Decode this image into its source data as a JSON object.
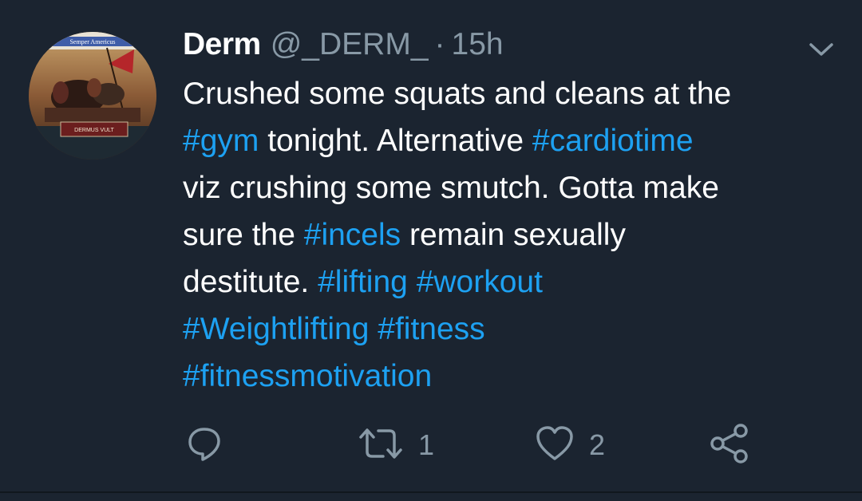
{
  "tweet": {
    "avatar": {
      "banner_text": "Semper Americus",
      "plaque_text": "DERMUS VULT"
    },
    "author": {
      "display_name": "Derm",
      "handle": "@_DERM_",
      "separator": "·",
      "time": "15h"
    },
    "menu_icon": "chevron-down-icon",
    "body_lines": [
      [
        {
          "text": "Crushed some squats and cleans at the",
          "hashtag": false
        }
      ],
      [
        {
          "text": "#gym",
          "hashtag": true
        },
        {
          "text": " tonight. Alternative ",
          "hashtag": false
        },
        {
          "text": "#cardiotime",
          "hashtag": true
        }
      ],
      [
        {
          "text": "viz crushing some smutch. Gotta make",
          "hashtag": false
        }
      ],
      [
        {
          "text": "sure the ",
          "hashtag": false
        },
        {
          "text": "#incels",
          "hashtag": true
        },
        {
          "text": " remain sexually",
          "hashtag": false
        }
      ],
      [
        {
          "text": "destitute. ",
          "hashtag": false
        },
        {
          "text": "#lifting",
          "hashtag": true
        },
        {
          "text": " ",
          "hashtag": false
        },
        {
          "text": "#workout",
          "hashtag": true
        }
      ],
      [
        {
          "text": "#Weightlifting",
          "hashtag": true
        },
        {
          "text": " ",
          "hashtag": false
        },
        {
          "text": "#fitness",
          "hashtag": true
        }
      ],
      [
        {
          "text": "#fitnessmotivation",
          "hashtag": true
        }
      ]
    ],
    "actions": {
      "reply": {
        "icon": "reply-icon",
        "count": ""
      },
      "retweet": {
        "icon": "retweet-icon",
        "count": "1"
      },
      "like": {
        "icon": "heart-icon",
        "count": "2"
      },
      "share": {
        "icon": "share-icon",
        "count": ""
      }
    }
  },
  "colors": {
    "background": "#1b2430",
    "text": "#ffffff",
    "secondary": "#8899a6",
    "hashtag": "#1da1f2"
  }
}
